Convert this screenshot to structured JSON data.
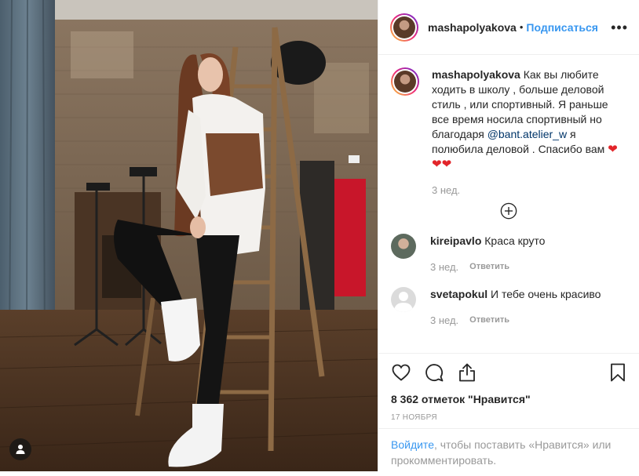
{
  "header": {
    "username": "mashapolyakova",
    "dot": "•",
    "follow_label": "Подписаться",
    "more_label": "•••"
  },
  "caption": {
    "username": "mashapolyakova",
    "text_part1": "Как вы любите ходить в школу , больше деловой стиль , или спортивный. Я раньше все время носила спортивный но благодаря ",
    "mention": "@bant.atelier_w",
    "text_part2": " я полюбила деловой . Спасибо вам ",
    "heart_1": "❤",
    "heart_2": "❤",
    "heart_3": "❤",
    "time": "3 нед."
  },
  "comments": [
    {
      "username": "kireipavlo",
      "text": "Краса круто",
      "time": "3 нед.",
      "reply_label": "Ответить"
    },
    {
      "username": "svetapokul",
      "text": "И тебе очень красиво",
      "time": "3 нед.",
      "reply_label": "Ответить"
    }
  ],
  "likes": "8 362 отметок \"Нравится\"",
  "date": "17 ноября",
  "login_prompt": {
    "link": "Войдите",
    "text": ", чтобы поставить «Нравится» или прокомментировать."
  },
  "icons": {
    "like": "heart-icon",
    "comment": "comment-icon",
    "share": "share-icon",
    "save": "bookmark-icon",
    "load_more": "plus-circle-icon",
    "user_tags": "user-icon"
  },
  "colors": {
    "link_blue": "#3897f0",
    "mention": "#003569",
    "heart_red": "#e2252a",
    "muted": "#999999"
  }
}
